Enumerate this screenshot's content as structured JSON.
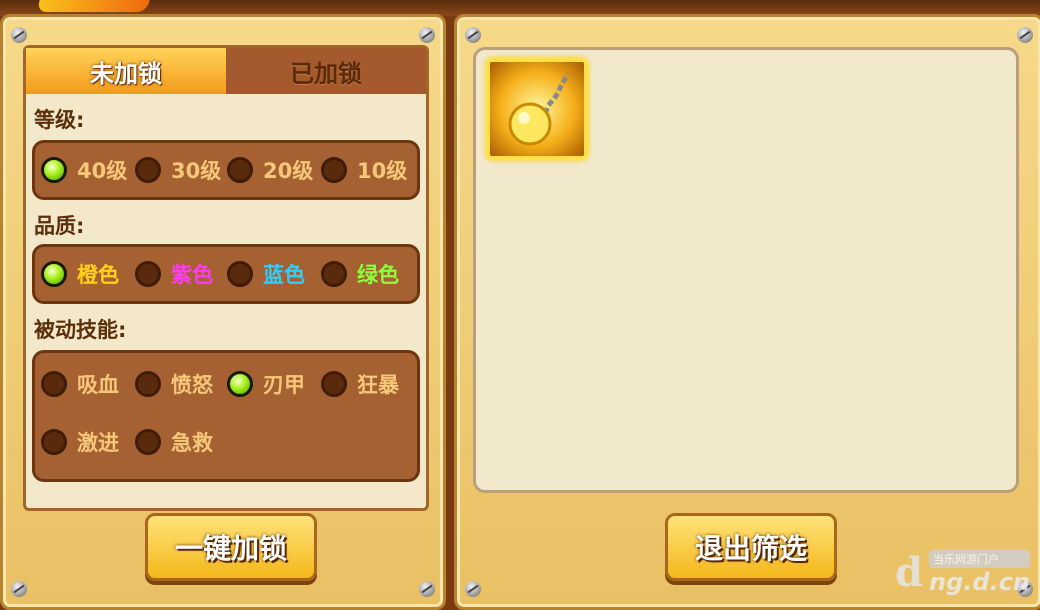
{
  "left_panel": {
    "tabs": [
      {
        "label": "未加锁",
        "active": true
      },
      {
        "label": "已加锁",
        "active": false
      }
    ],
    "level": {
      "title": "等级:",
      "options": [
        {
          "label": "40级",
          "selected": true
        },
        {
          "label": "30级",
          "selected": false
        },
        {
          "label": "20级",
          "selected": false
        },
        {
          "label": "10级",
          "selected": false
        }
      ]
    },
    "quality": {
      "title": "品质:",
      "options": [
        {
          "label": "橙色",
          "selected": true,
          "color": "#ffd21a"
        },
        {
          "label": "紫色",
          "selected": false,
          "color": "#ff3cf0"
        },
        {
          "label": "蓝色",
          "selected": false,
          "color": "#2fd0ff"
        },
        {
          "label": "绿色",
          "selected": false,
          "color": "#8cff3c"
        }
      ]
    },
    "passive": {
      "title": "被动技能:",
      "options": [
        {
          "label": "吸血",
          "selected": false
        },
        {
          "label": "愤怒",
          "selected": false
        },
        {
          "label": "刃甲",
          "selected": true
        },
        {
          "label": "狂暴",
          "selected": false
        },
        {
          "label": "激进",
          "selected": false
        },
        {
          "label": "急救",
          "selected": false
        }
      ]
    },
    "lock_button": "一键加锁"
  },
  "right_panel": {
    "items": [
      {
        "icon": "ball-and-chain-icon",
        "rarity": "orange"
      }
    ],
    "exit_button": "退出筛选"
  },
  "watermark": {
    "site_cn": "当乐网游门户",
    "url": "ng.d.cn"
  }
}
